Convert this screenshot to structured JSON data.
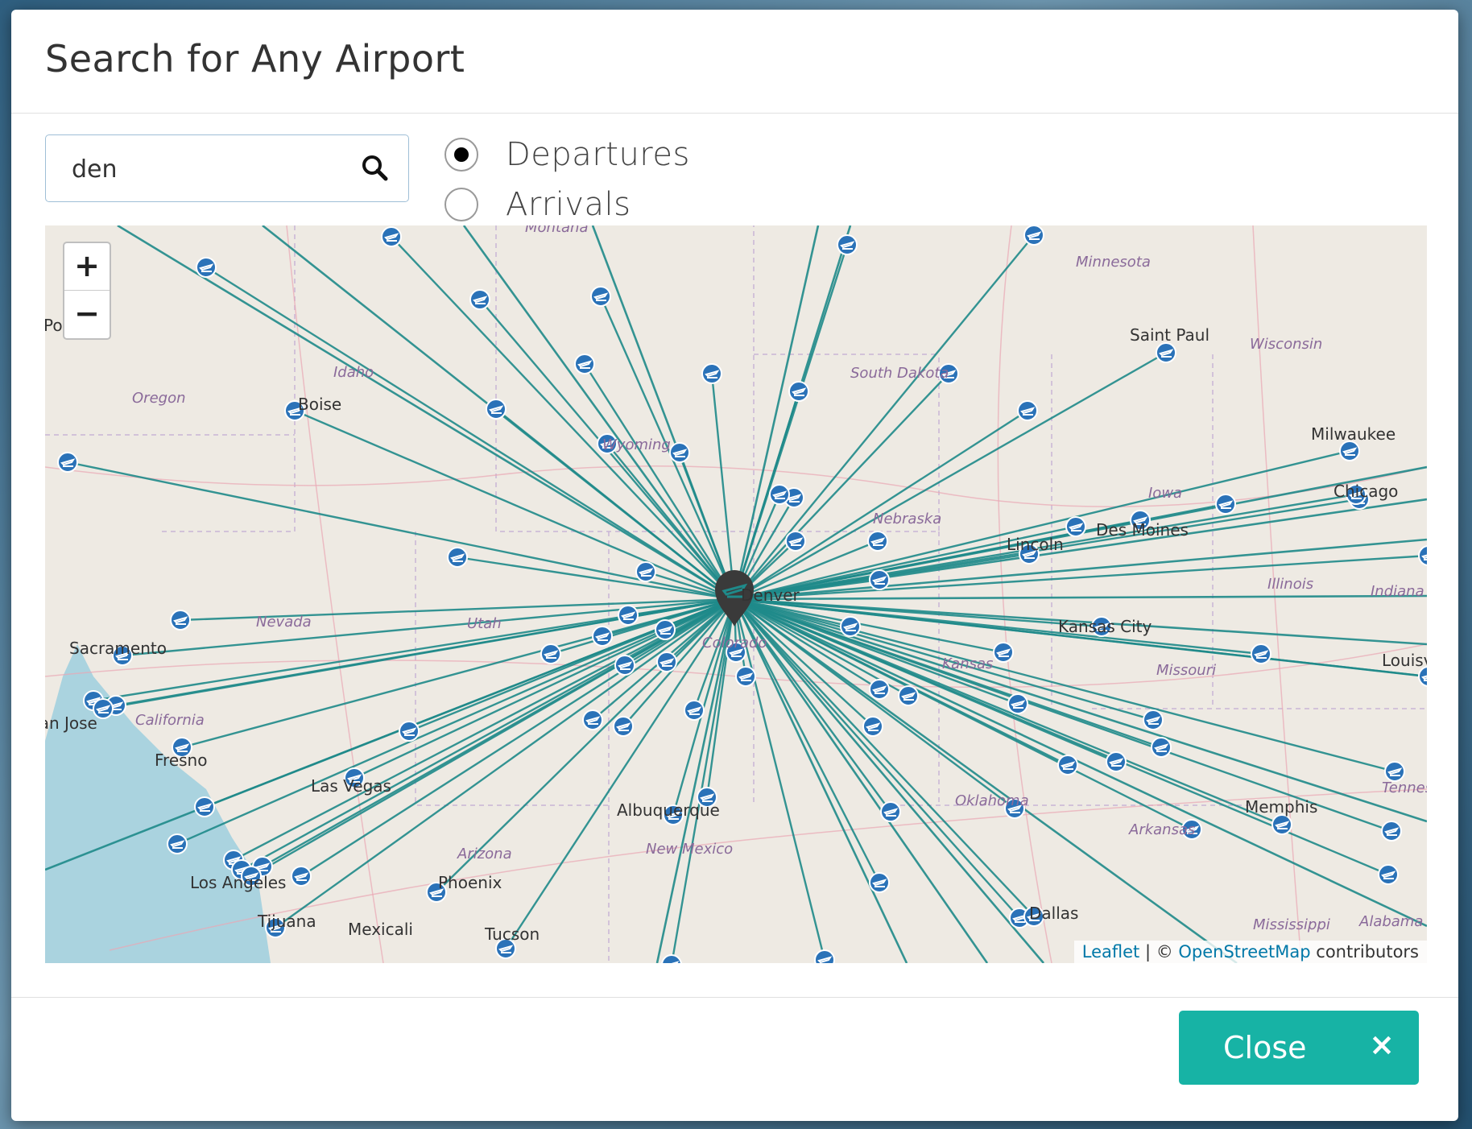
{
  "modal": {
    "title": "Search for Any Airport"
  },
  "search": {
    "value": "den",
    "icon": "search-icon"
  },
  "direction": {
    "options": [
      {
        "label": "Departures",
        "checked": true
      },
      {
        "label": "Arrivals",
        "checked": false
      }
    ]
  },
  "map": {
    "zoom_in": "+",
    "zoom_out": "−",
    "route_color": "#1f8a8a",
    "airport_marker_color": "#2a72b8",
    "hub_marker_color": "#3a3a3a",
    "attribution": {
      "leaflet": "Leaflet",
      "sep": " | © ",
      "osm": "OpenStreetMap",
      "suffix": " contributors"
    },
    "city_labels": [
      "Montana",
      "Minnesota",
      "Saint Paul",
      "Wisconsin",
      "Milwaukee",
      "Chicago",
      "Iowa",
      "Des Moines",
      "Illinois",
      "Indiana",
      "Oregon",
      "Idaho",
      "Boise",
      "South Dakota",
      "Wyoming",
      "Nebraska",
      "Lincoln",
      "Nevada",
      "Utah",
      "Colorado",
      "Sacramento",
      "San Jose",
      "California",
      "Fresno",
      "Las Vegas",
      "Kansas",
      "Kansas City",
      "Missouri",
      "Louisville",
      "Los Angeles",
      "Tijuana",
      "Mexicali",
      "Arizona",
      "Phoenix",
      "Tucson",
      "Albuquerque",
      "New Mexico",
      "Oklahoma",
      "Arkansas",
      "Memphis",
      "Tennessee",
      "Dallas",
      "Mississippi",
      "Alabama",
      "Denver",
      "Po"
    ]
  },
  "footer": {
    "close_label": "Close",
    "close_icon": "×"
  }
}
